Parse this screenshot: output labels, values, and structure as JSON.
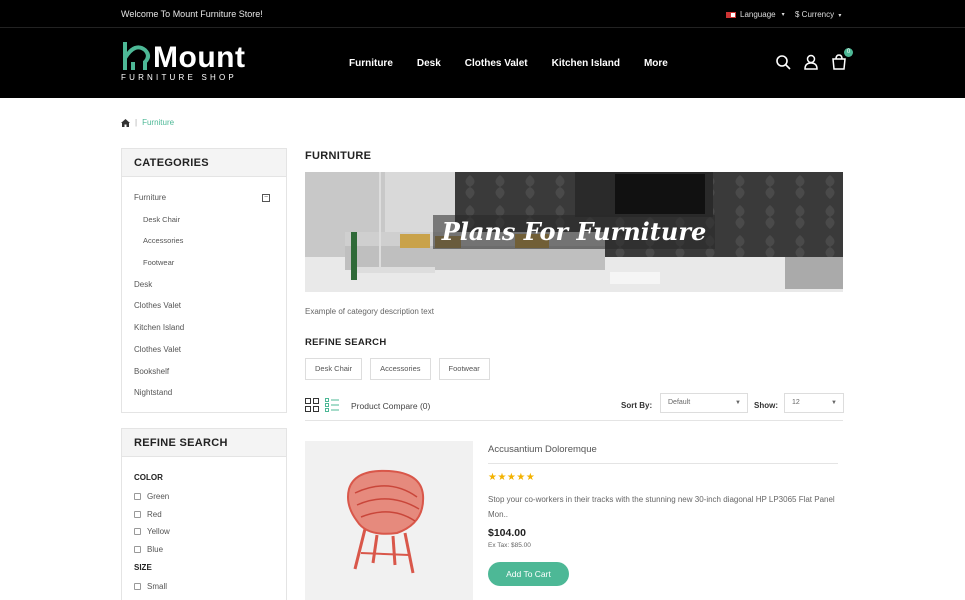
{
  "topbar": {
    "welcome": "Welcome To Mount Furniture Store!",
    "language": "Language",
    "currency": "$ Currency"
  },
  "logo": {
    "word": "Mount",
    "tagline": "FURNITURE SHOP"
  },
  "nav": [
    "Furniture",
    "Desk",
    "Clothes Valet",
    "Kitchen Island",
    "More"
  ],
  "cart": {
    "count": "0"
  },
  "breadcrumb": {
    "current": "Furniture",
    "separator": "|"
  },
  "categories": {
    "title": "CATEGORIES",
    "items": [
      {
        "label": "Furniture",
        "sub": false,
        "expanded": true
      },
      {
        "label": "Desk Chair",
        "sub": true
      },
      {
        "label": "Accessories",
        "sub": true
      },
      {
        "label": "Footwear",
        "sub": true
      },
      {
        "label": "Desk",
        "sub": false
      },
      {
        "label": "Clothes Valet",
        "sub": false
      },
      {
        "label": "Kitchen Island",
        "sub": false
      },
      {
        "label": "Clothes Valet",
        "sub": false
      },
      {
        "label": "Bookshelf",
        "sub": false
      },
      {
        "label": "Nightstand",
        "sub": false
      }
    ]
  },
  "refine_sidebar": {
    "title": "REFINE SEARCH",
    "color_heading": "COLOR",
    "colors": [
      "Green",
      "Red",
      "Yellow",
      "Blue"
    ],
    "size_heading": "SIZE",
    "sizes": [
      "Small"
    ]
  },
  "main": {
    "title": "FURNITURE",
    "banner_text": "Plans For Furniture",
    "description": "Example of category description text",
    "refine_title": "REFINE SEARCH",
    "refine_chips": [
      "Desk Chair",
      "Accessories",
      "Footwear"
    ],
    "compare": "Product Compare (0)",
    "sort_label": "Sort By:",
    "sort_value": "Default",
    "show_label": "Show:",
    "show_value": "12"
  },
  "product": {
    "name": "Accusantium Doloremque",
    "rating": 5,
    "stars": "★★★★★",
    "description": "Stop your co-workers in their tracks with the stunning new 30-inch diagonal HP LP3065 Flat Panel Mon..",
    "price": "$104.00",
    "ex_tax": "Ex Tax: $85.00",
    "button": "Add To Cart"
  },
  "colors": {
    "accent": "#4db896",
    "dark": "#000000",
    "star": "#f3b200"
  }
}
